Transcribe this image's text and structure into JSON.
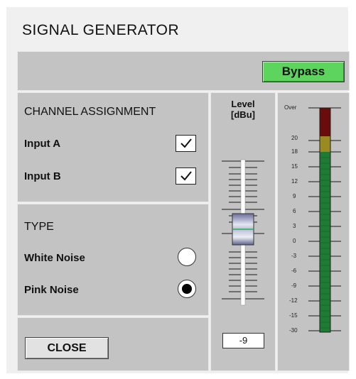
{
  "title": "SIGNAL GENERATOR",
  "bypass_label": "Bypass",
  "close_label": "CLOSE",
  "channel_assignment": {
    "title": "CHANNEL ASSIGNMENT",
    "inputs": [
      {
        "label": "Input A",
        "checked": true
      },
      {
        "label": "Input B",
        "checked": true
      }
    ]
  },
  "type": {
    "title": "TYPE",
    "options": [
      {
        "label": "White Noise",
        "selected": false
      },
      {
        "label": "Pink Noise",
        "selected": true
      }
    ]
  },
  "level": {
    "title_line1": "Level",
    "title_line2": "[dBu]",
    "value": "-9"
  },
  "meter": {
    "scale_labels": [
      "Over",
      "20",
      "18",
      "15",
      "12",
      "9",
      "6",
      "3",
      "0",
      "-3",
      "-6",
      "-9",
      "-12",
      "-15",
      "-30"
    ]
  },
  "colors": {
    "bypass_active": "#5dd45d",
    "meter_green": "#1e7b33",
    "meter_yellow": "#9a8a20",
    "meter_red": "#6a0c0c",
    "panel_gray": "#c3c3c3"
  }
}
